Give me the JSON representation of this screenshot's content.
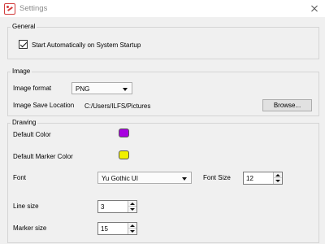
{
  "window": {
    "title": "Settings",
    "icon": "app-logo-icon",
    "close_icon": "close-icon"
  },
  "general": {
    "title": "General",
    "startup_label": "Start Automatically on System Startup",
    "startup_checked": true
  },
  "image": {
    "title": "Image",
    "format_label": "Image format",
    "format_value": "PNG",
    "save_location_label": "Image Save Location",
    "save_location_value": "C:/Users/ILFS/Pictures",
    "browse_label": "Browse..."
  },
  "drawing": {
    "title": "Drawing",
    "default_color_label": "Default Color",
    "default_color": "#a800e0",
    "default_marker_color_label": "Default Marker Color",
    "default_marker_color": "#f0f000",
    "font_label": "Font",
    "font_value": "Yu Gothic UI",
    "font_size_label": "Font Size",
    "font_size_value": "12",
    "line_size_label": "Line size",
    "line_size_value": "3",
    "marker_size_label": "Marker size",
    "marker_size_value": "15"
  }
}
